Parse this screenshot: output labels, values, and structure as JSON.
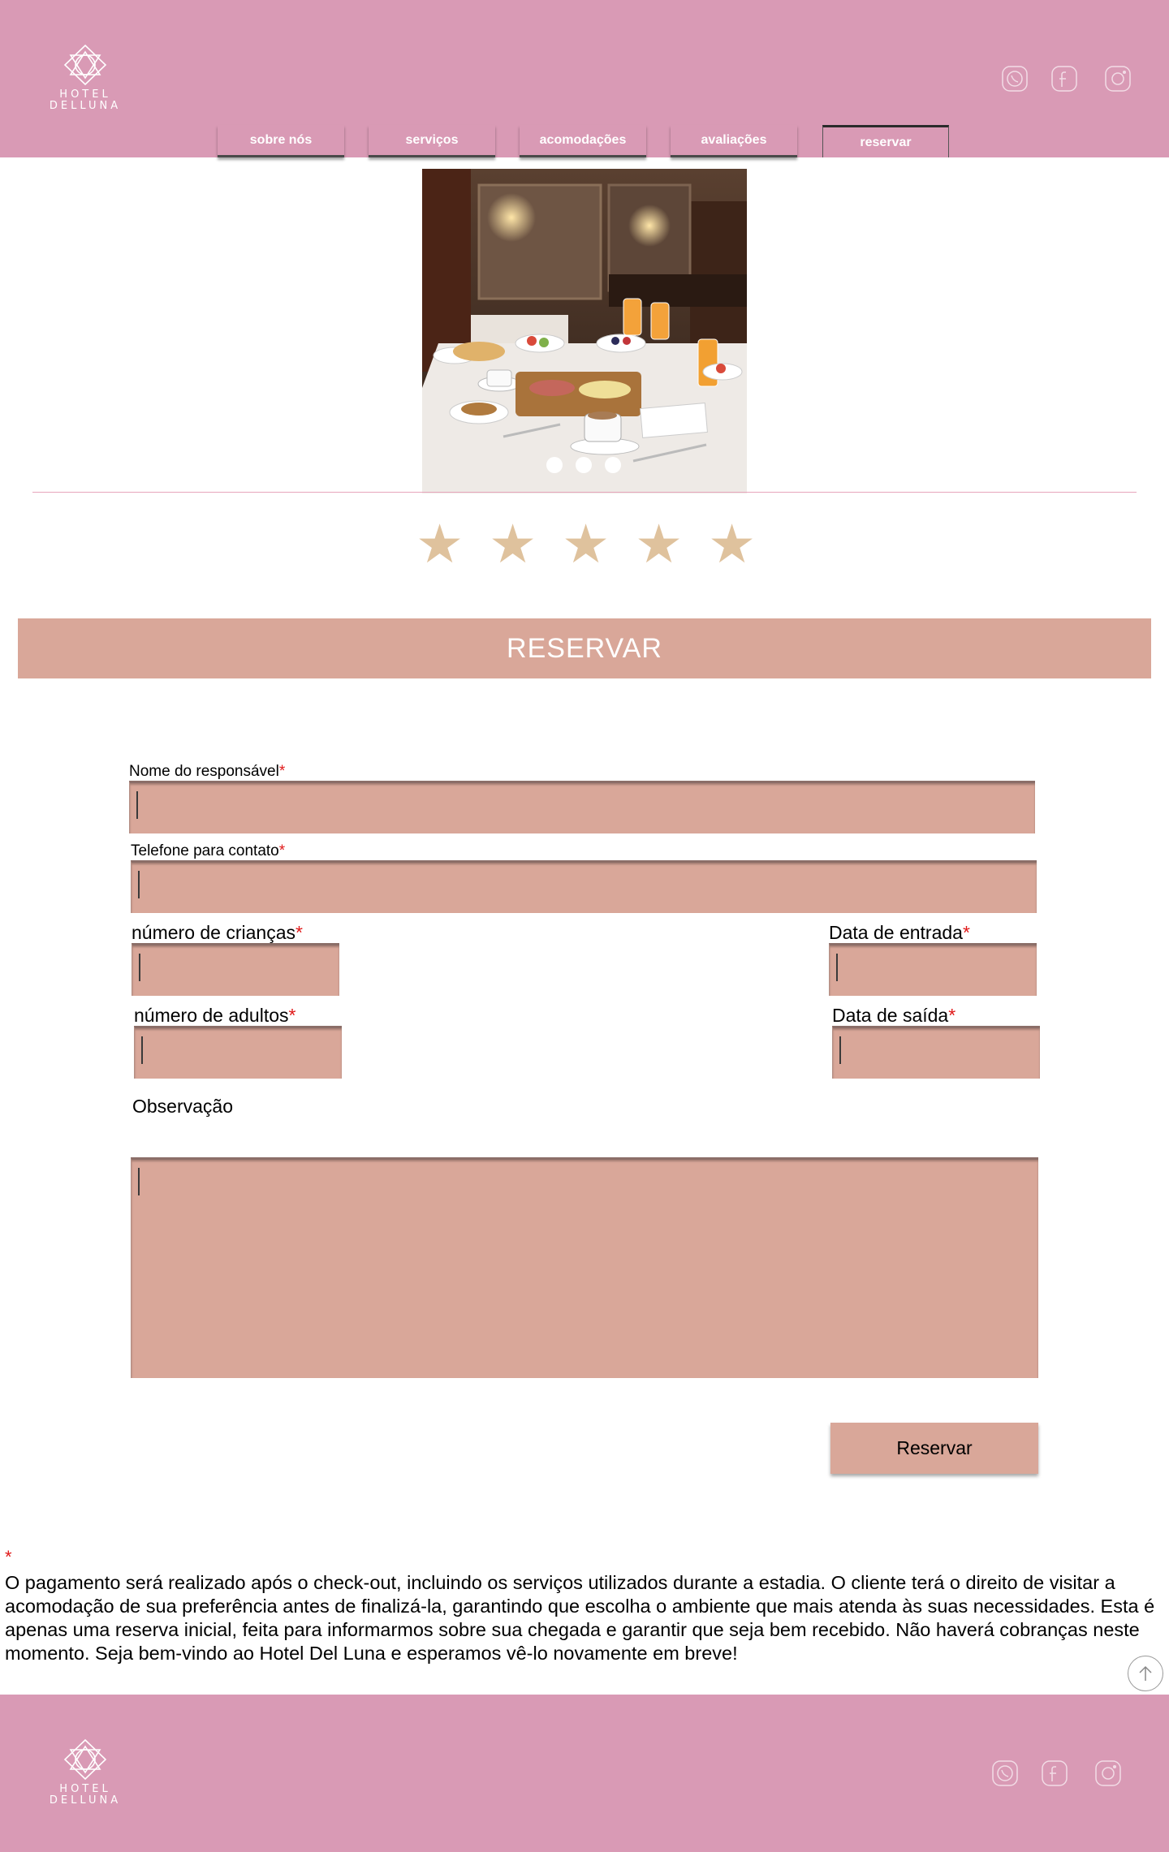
{
  "brand": {
    "line1": "HOTEL",
    "line2": "DELLUNA"
  },
  "social": [
    "whatsapp-icon",
    "facebook-icon",
    "instagram-icon"
  ],
  "nav": {
    "tabs": [
      {
        "label": "sobre nós"
      },
      {
        "label": "serviços"
      },
      {
        "label": "acomodações"
      },
      {
        "label": "avaliações"
      },
      {
        "label": "reservar"
      }
    ],
    "active": "reservar"
  },
  "carousel": {
    "slides": 3,
    "current": 1
  },
  "rating": {
    "stars": 5,
    "max": 5,
    "symbol": "★"
  },
  "section_title": "RESERVAR",
  "form": {
    "required_mark": "*",
    "responsible_label": "Nome do responsável",
    "phone_label": "Telefone para contato",
    "children_label": "número de crianças",
    "adults_label": "número de adultos",
    "checkin_label": "Data de entrada",
    "checkout_label": "Data de saída",
    "notes_label": "Observação",
    "submit_label": "Reservar"
  },
  "note": {
    "mark": "*",
    "text": "O pagamento será realizado após o check-out, incluindo os serviços utilizados durante a estadia. O cliente terá o direito de visitar a acomodação de sua preferência antes de finalizá-la, garantindo que escolha o ambiente que mais atenda às suas necessidades. Esta é apenas uma reserva inicial, feita para informarmos sobre sua chegada e garantir que seja bem recebido. Não haverá cobranças neste momento. Seja bem-vindo ao Hotel Del Luna e esperamos vê-lo novamente em breve!"
  },
  "colors": {
    "header_pink": "#d99ab5",
    "field_rose": "#d9a799",
    "star_gold": "#dfc29d",
    "required_red": "#e01919"
  }
}
